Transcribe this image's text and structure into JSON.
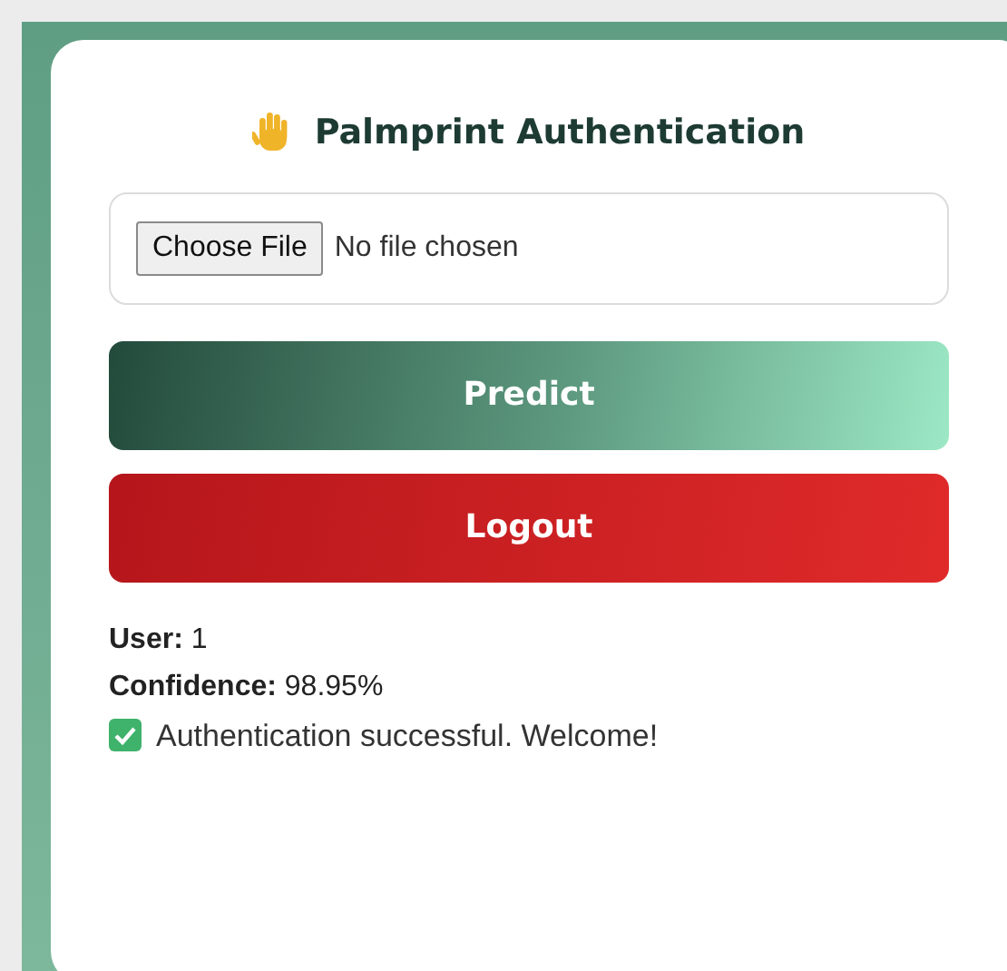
{
  "title": "Palmprint Authentication",
  "file_input": {
    "button": "Choose File",
    "status": "No file chosen"
  },
  "buttons": [
    {
      "label": "Predict",
      "kind": "predict"
    },
    {
      "label": "Logout",
      "kind": "logout"
    }
  ],
  "result": {
    "lines": [
      "**User:** 1",
      "**Confidence:** 98.95%"
    ],
    "message": "Authentication successful. Welcome!",
    "success": true
  }
}
